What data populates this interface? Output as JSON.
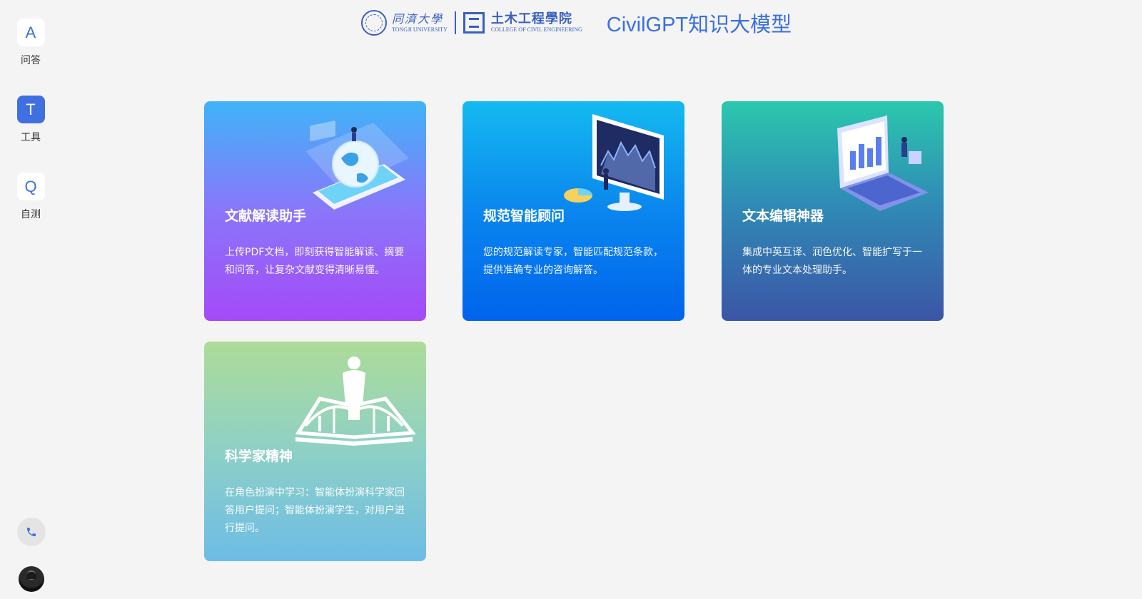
{
  "sidebar": {
    "items": [
      {
        "badge": "A",
        "label": "问答"
      },
      {
        "badge": "T",
        "label": "工具"
      },
      {
        "badge": "Q",
        "label": "自测"
      }
    ]
  },
  "header": {
    "tongji_cn": "同濟大學",
    "tongji_en": "TONGJI UNIVERSITY",
    "college_cn": "土木工程學院",
    "college_en": "COLLEGE OF CIVIL ENGINEERING",
    "title": "CivilGPT知识大模型"
  },
  "cards": [
    {
      "title": "文献解读助手",
      "desc": "上传PDF文档，即刻获得智能解读、摘要和问答，让复杂文献变得清晰易懂。"
    },
    {
      "title": "规范智能顾问",
      "desc": "您的规范解读专家，智能匹配规范条款，提供准确专业的咨询解答。"
    },
    {
      "title": "文本编辑神器",
      "desc": "集成中英互译、润色优化、智能扩写于一体的专业文本处理助手。"
    },
    {
      "title": "科学家精神",
      "desc": "在角色扮演中学习：智能体扮演科学家回答用户提问；智能体扮演学生，对用户进行提问。"
    }
  ],
  "colors": {
    "accent": "#3f6fe0",
    "background": "#f4f4f4"
  }
}
